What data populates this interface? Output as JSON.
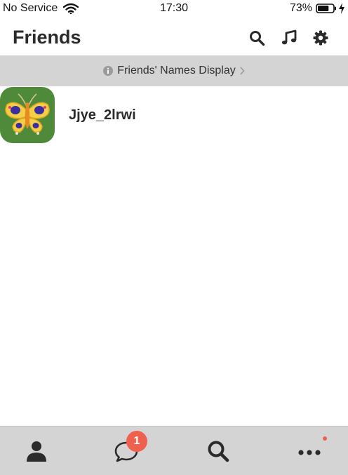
{
  "status_bar": {
    "carrier": "No Service",
    "time": "17:30",
    "battery": "73%",
    "battery_level": 0.73
  },
  "header": {
    "title": "Friends",
    "icons": [
      "search-icon",
      "music-note-icon",
      "gear-icon"
    ]
  },
  "banner": {
    "text": "Friends' Names Display"
  },
  "friends": [
    {
      "name": "Jjye_2lrwi",
      "avatar": "butterfly-icon"
    }
  ],
  "tab_bar": {
    "tabs": [
      "person-icon",
      "chat-bubble-icon",
      "search-icon",
      "more-icon"
    ],
    "chats_badge": "1"
  },
  "colors": {
    "accent": "#f0604f",
    "bar_bg": "#d4d4d4",
    "avatar_bg": "#4f8a3b"
  }
}
